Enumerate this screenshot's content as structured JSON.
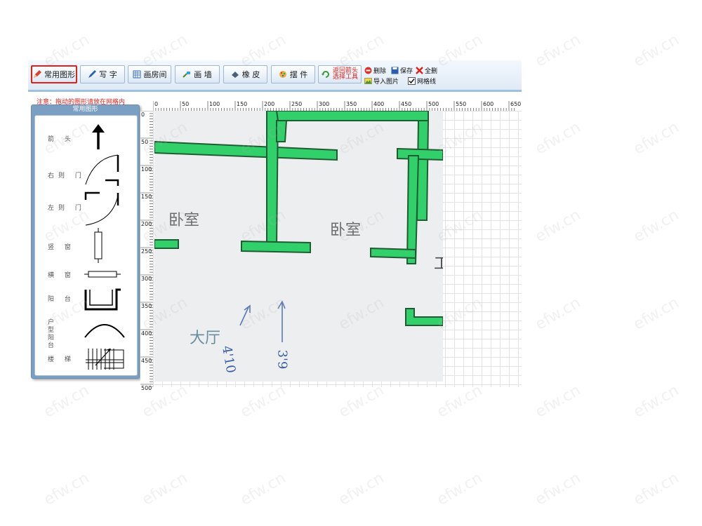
{
  "toolbar": {
    "common_shapes": "常用图形",
    "write_text": "写 字",
    "draw_room": "画房间",
    "draw_wall": "画 墙",
    "eraser": "橡 皮",
    "place_item": "摆 件",
    "return_arrow_line1": "返回箭头",
    "return_arrow_line2": "选择工具",
    "delete": "删除",
    "save": "保存",
    "delete_all": "全删",
    "import_image": "导入图片",
    "grid_lines": "网格线"
  },
  "grid_checked": true,
  "warning": "注意：拖动的图形请放在网格内",
  "panel": {
    "title": "常用图形",
    "items": [
      {
        "label": "箭 头",
        "icon": "arrow-icon"
      },
      {
        "label": "右则 门",
        "icon": "right-door-icon"
      },
      {
        "label": "左则 门",
        "icon": "left-door-icon"
      },
      {
        "label": "竖 窗",
        "icon": "vertical-window-icon"
      },
      {
        "label": "横 窗",
        "icon": "horizontal-window-icon"
      },
      {
        "label": "阳 台",
        "icon": "balcony-icon"
      },
      {
        "label": "户 型 阳 台",
        "icon": "unit-balcony-icon"
      },
      {
        "label": "楼 梯",
        "icon": "stairs-icon"
      }
    ]
  },
  "ruler": {
    "top": [
      "0",
      "50",
      "100",
      "150",
      "200",
      "250",
      "300",
      "350",
      "400",
      "450",
      "500",
      "550",
      "600",
      "650"
    ],
    "left": [
      "0",
      "50",
      "100",
      "150",
      "200",
      "250",
      "300",
      "350",
      "400",
      "450",
      "500"
    ]
  },
  "floorplan": {
    "rooms": [
      "卧室",
      "卧室",
      "大厅"
    ],
    "handwritten": [
      "4'10",
      "3'9"
    ],
    "partial_char": "工"
  },
  "colors": {
    "wall": "#32d06a",
    "wall_edge": "#1f5c33",
    "accent_red": "#e0201b",
    "panel_blue": "#7b9ec3"
  },
  "watermark": "efw.cn"
}
